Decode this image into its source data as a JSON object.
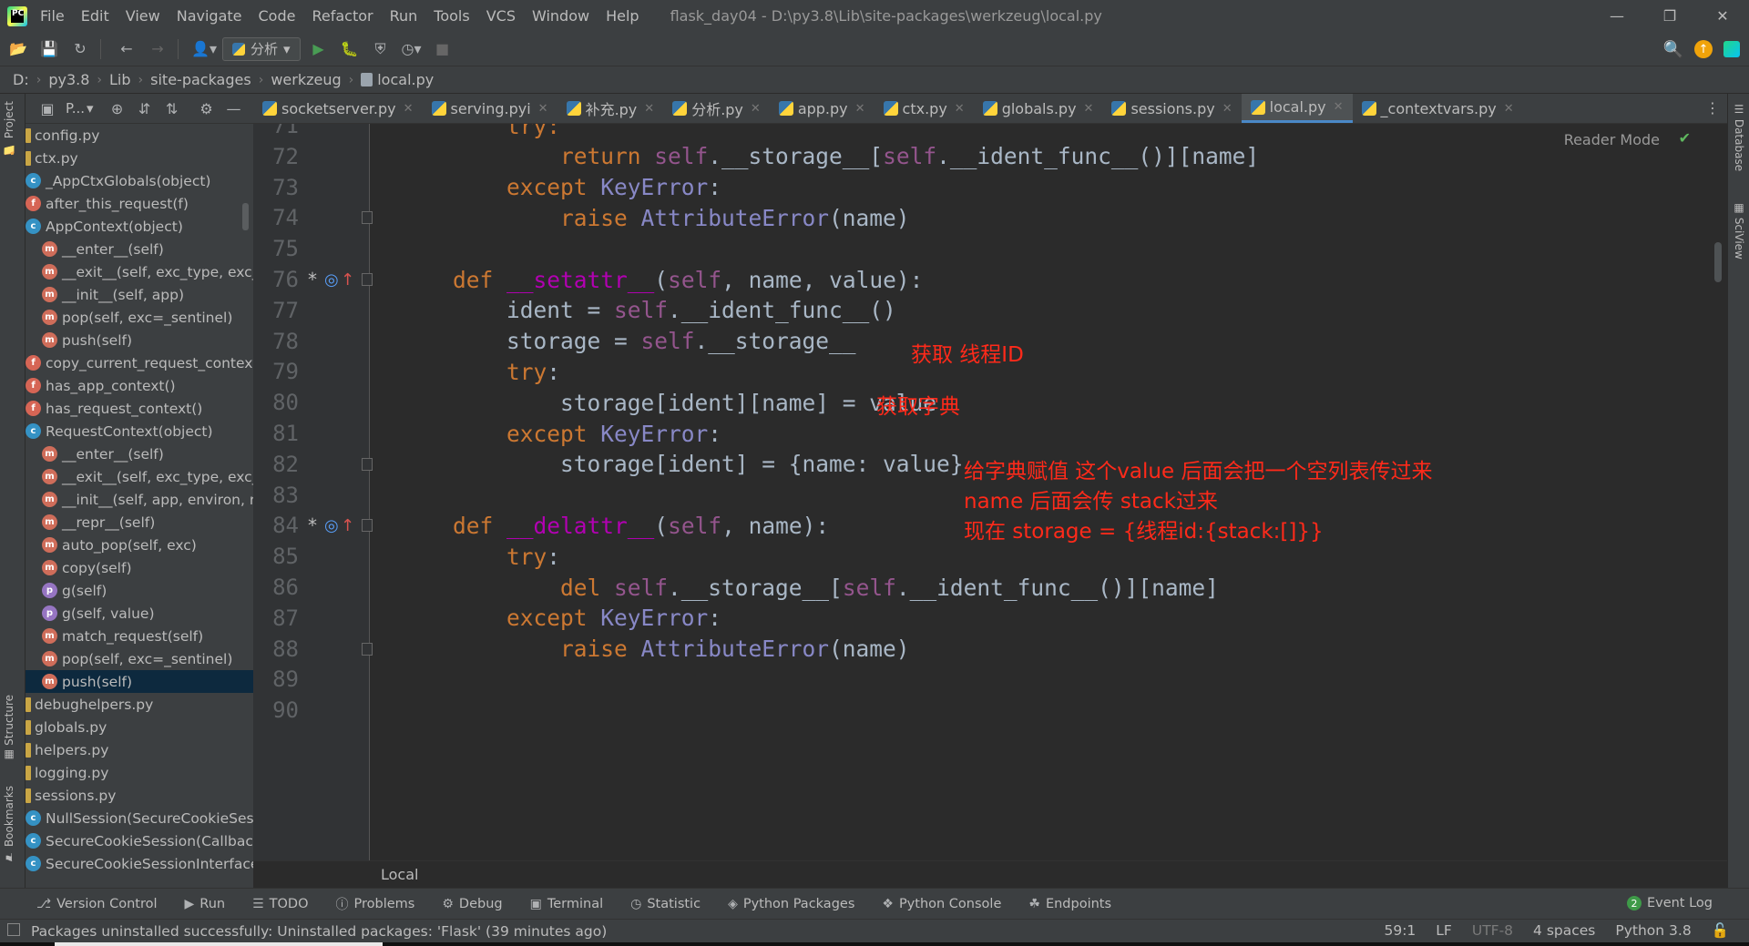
{
  "menu": {
    "items": [
      "File",
      "Edit",
      "View",
      "Navigate",
      "Code",
      "Refactor",
      "Run",
      "Tools",
      "VCS",
      "Window",
      "Help"
    ],
    "window_title": "flask_day04 - D:\\py3.8\\Lib\\site-packages\\werkzeug\\local.py"
  },
  "toolbar": {
    "run_config": "分析"
  },
  "breadcrumb": [
    "D:",
    "py3.8",
    "Lib",
    "site-packages",
    "werkzeug",
    "local.py"
  ],
  "left_strip": {
    "project": "Project",
    "structure": "Structure",
    "bookmarks": "Bookmarks"
  },
  "right_strip": {
    "database": "Database",
    "sciview": "SciView"
  },
  "project_panel": {
    "title": "P...",
    "tree": [
      {
        "kind": "file",
        "label": "config.py",
        "indent": 0
      },
      {
        "kind": "file",
        "label": "ctx.py",
        "indent": 0
      },
      {
        "kind": "c",
        "label": "_AppCtxGlobals(object)",
        "indent": 1
      },
      {
        "kind": "f",
        "label": "after_this_request(f)",
        "indent": 1
      },
      {
        "kind": "c",
        "label": "AppContext(object)",
        "indent": 1
      },
      {
        "kind": "m",
        "label": "__enter__(self)",
        "indent": 2
      },
      {
        "kind": "m",
        "label": "__exit__(self, exc_type, exc_",
        "indent": 2
      },
      {
        "kind": "m",
        "label": "__init__(self, app)",
        "indent": 2
      },
      {
        "kind": "m",
        "label": "pop(self, exc=_sentinel)",
        "indent": 2
      },
      {
        "kind": "m",
        "label": "push(self)",
        "indent": 2
      },
      {
        "kind": "f",
        "label": "copy_current_request_context",
        "indent": 1
      },
      {
        "kind": "f",
        "label": "has_app_context()",
        "indent": 1
      },
      {
        "kind": "f",
        "label": "has_request_context()",
        "indent": 1
      },
      {
        "kind": "c",
        "label": "RequestContext(object)",
        "indent": 1
      },
      {
        "kind": "m",
        "label": "__enter__(self)",
        "indent": 2
      },
      {
        "kind": "m",
        "label": "__exit__(self, exc_type, exc_",
        "indent": 2
      },
      {
        "kind": "m",
        "label": "__init__(self, app, environ, re",
        "indent": 2
      },
      {
        "kind": "m",
        "label": "__repr__(self)",
        "indent": 2
      },
      {
        "kind": "m",
        "label": "auto_pop(self, exc)",
        "indent": 2
      },
      {
        "kind": "m",
        "label": "copy(self)",
        "indent": 2
      },
      {
        "kind": "p",
        "label": "g(self)",
        "indent": 2
      },
      {
        "kind": "p",
        "label": "g(self, value)",
        "indent": 2
      },
      {
        "kind": "m",
        "label": "match_request(self)",
        "indent": 2
      },
      {
        "kind": "m",
        "label": "pop(self, exc=_sentinel)",
        "indent": 2
      },
      {
        "kind": "m",
        "label": "push(self)",
        "indent": 2,
        "selected": true
      },
      {
        "kind": "file",
        "label": "debughelpers.py",
        "indent": 0
      },
      {
        "kind": "file",
        "label": "globals.py",
        "indent": 0
      },
      {
        "kind": "file",
        "label": "helpers.py",
        "indent": 0
      },
      {
        "kind": "file",
        "label": "logging.py",
        "indent": 0
      },
      {
        "kind": "file",
        "label": "sessions.py",
        "indent": 0
      },
      {
        "kind": "c",
        "label": "NullSession(SecureCookieSess",
        "indent": 1
      },
      {
        "kind": "c",
        "label": "SecureCookieSession(Callback",
        "indent": 1
      },
      {
        "kind": "c",
        "label": "SecureCookieSessionInterface",
        "indent": 1
      }
    ]
  },
  "editor_tabs": [
    {
      "label": "socketserver.py"
    },
    {
      "label": "serving.pyi"
    },
    {
      "label": "补充.py"
    },
    {
      "label": "分析.py"
    },
    {
      "label": "app.py"
    },
    {
      "label": "ctx.py"
    },
    {
      "label": "globals.py"
    },
    {
      "label": "sessions.py"
    },
    {
      "label": "local.py",
      "active": true
    },
    {
      "label": "_contextvars.py"
    }
  ],
  "editor": {
    "reader_mode": "Reader Mode",
    "footer_crumb": "Local",
    "lines": [
      {
        "n": "71",
        "fold": false,
        "html": "<span class=\"kw\">        try:</span>"
      },
      {
        "n": "72",
        "fold": false,
        "html": "            <span class=\"kw\">return </span><span class=\"slf\">self</span>.__storage__[<span class=\"slf\">self</span>.__ident_func__()][name]"
      },
      {
        "n": "73",
        "fold": false,
        "html": "        <span class=\"kw\">except </span><span class=\"bi\">KeyError</span>:"
      },
      {
        "n": "74",
        "fold": true,
        "html": "            <span class=\"kw\">raise </span><span class=\"bi\">AttributeError</span>(name)"
      },
      {
        "n": "75",
        "fold": false,
        "html": ""
      },
      {
        "n": "76",
        "fold": true,
        "mark": true,
        "html": "    <span class=\"kw\">def </span><span class=\"mg\">__setattr__</span>(<span class=\"slf\">self</span>, name, value):"
      },
      {
        "n": "77",
        "fold": false,
        "html": "        ident = <span class=\"slf\">self</span>.__ident_func__()"
      },
      {
        "n": "78",
        "fold": false,
        "html": "        storage = <span class=\"slf\">self</span>.__storage__"
      },
      {
        "n": "79",
        "fold": false,
        "html": "        <span class=\"kw\">try</span>:"
      },
      {
        "n": "80",
        "fold": false,
        "html": "            storage[ident][name] = value"
      },
      {
        "n": "81",
        "fold": false,
        "html": "        <span class=\"kw\">except </span><span class=\"bi\">KeyError</span>:"
      },
      {
        "n": "82",
        "fold": true,
        "html": "            storage[ident] = {name: value}"
      },
      {
        "n": "83",
        "fold": false,
        "html": ""
      },
      {
        "n": "84",
        "fold": true,
        "mark": true,
        "html": "    <span class=\"kw\">def </span><span class=\"mg\">__delattr__</span>(<span class=\"slf\">self</span>, name):"
      },
      {
        "n": "85",
        "fold": false,
        "html": "        <span class=\"kw\">try</span>:"
      },
      {
        "n": "86",
        "fold": false,
        "html": "            <span class=\"kw\">del </span><span class=\"slf\">self</span>.__storage__[<span class=\"slf\">self</span>.__ident_func__()][name]"
      },
      {
        "n": "87",
        "fold": false,
        "html": "        <span class=\"kw\">except </span><span class=\"bi\">KeyError</span>:"
      },
      {
        "n": "88",
        "fold": true,
        "html": "            <span class=\"kw\">raise </span><span class=\"bi\">AttributeError</span>(name)"
      },
      {
        "n": "89",
        "fold": false,
        "html": ""
      },
      {
        "n": "90",
        "fold": false,
        "html": ""
      }
    ],
    "annotations": {
      "a1": "获取 线程ID",
      "a2": "获取字典",
      "a3": "给字典赋值 这个value 后面会把一个空列表传过来",
      "a4": "name 后面会传 stack过来",
      "a5": "现在 storage = {线程id:{stack:[]}}"
    }
  },
  "bottom_tabs": [
    "Version Control",
    "Run",
    "TODO",
    "Problems",
    "Debug",
    "Terminal",
    "Statistic",
    "Python Packages",
    "Python Console",
    "Endpoints"
  ],
  "event_log": {
    "count": "2",
    "label": "Event Log"
  },
  "status": {
    "message": "Packages uninstalled successfully: Uninstalled packages: 'Flask' (39 minutes ago)",
    "position": "59:1",
    "line_sep": "LF",
    "encoding": "UTF-8",
    "indent": "4 spaces",
    "interpreter": "Python 3.8"
  },
  "colors": {
    "annotation": "#ff2a1a",
    "keyword": "#cc7832",
    "self": "#94558d",
    "magic": "#b200b2",
    "accent": "#4a88c7"
  }
}
